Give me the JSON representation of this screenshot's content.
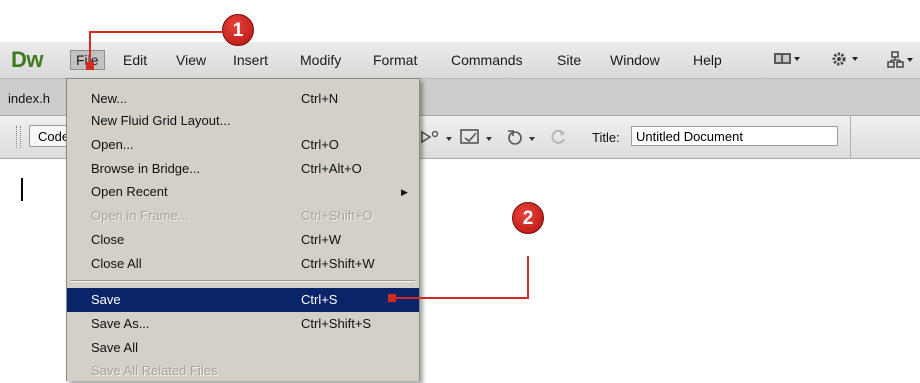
{
  "app": {
    "logo": "Dw",
    "menus": [
      "File",
      "Edit",
      "View",
      "Insert",
      "Modify",
      "Format",
      "Commands",
      "Site",
      "Window",
      "Help"
    ],
    "active_menu": "File",
    "toolbar_icons": [
      "layout-icon",
      "gear-icon",
      "site-icon"
    ]
  },
  "tabs": {
    "document_tab": "index.h"
  },
  "doc_toolbar": {
    "code_button": "Code",
    "title_label": "Title:",
    "title_value": "Untitled Document"
  },
  "file_menu": {
    "items": [
      {
        "label": "New...",
        "shortcut": "Ctrl+N",
        "state": "normal"
      },
      {
        "label": "New Fluid Grid Layout...",
        "shortcut": "",
        "state": "normal"
      },
      {
        "label": "Open...",
        "shortcut": "Ctrl+O",
        "state": "normal"
      },
      {
        "label": "Browse in Bridge...",
        "shortcut": "Ctrl+Alt+O",
        "state": "normal"
      },
      {
        "label": "Open Recent",
        "shortcut": "",
        "state": "submenu"
      },
      {
        "label": "Open in Frame...",
        "shortcut": "Ctrl+Shift+O",
        "state": "disabled"
      },
      {
        "label": "Close",
        "shortcut": "Ctrl+W",
        "state": "normal"
      },
      {
        "label": "Close All",
        "shortcut": "Ctrl+Shift+W",
        "state": "normal"
      },
      {
        "label": "Save",
        "shortcut": "Ctrl+S",
        "state": "highlighted"
      },
      {
        "label": "Save As...",
        "shortcut": "Ctrl+Shift+S",
        "state": "normal"
      },
      {
        "label": "Save All",
        "shortcut": "",
        "state": "normal"
      },
      {
        "label": "Save All Related Files",
        "shortcut": "",
        "state": "disabled"
      }
    ]
  },
  "callouts": [
    {
      "number": "1",
      "points_to": "File"
    },
    {
      "number": "2",
      "points_to": "Save"
    }
  ],
  "colors": {
    "logo": "#3f7a1f",
    "menu_background": "#d4d0c8",
    "highlight": "#0a246a",
    "callout": "#d42a22"
  }
}
